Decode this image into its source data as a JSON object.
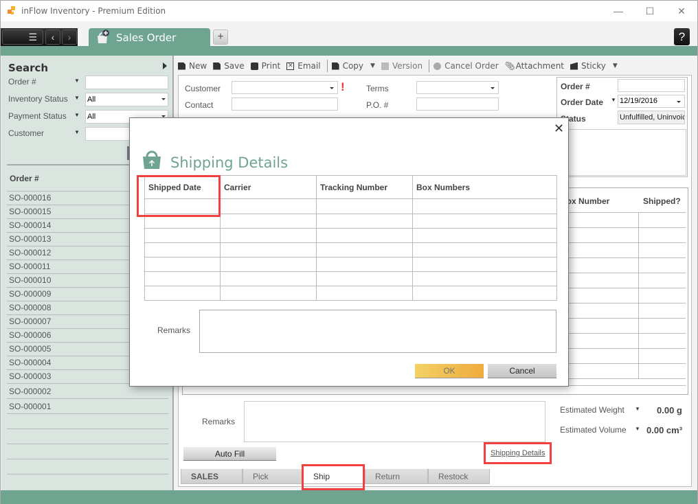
{
  "window": {
    "title": "inFlow Inventory - Premium Edition",
    "minimize": "—",
    "maximize": "☐",
    "close": "✕"
  },
  "tabs": {
    "active": "Sales Order",
    "add": "+",
    "help": "?"
  },
  "toolbar": {
    "items": [
      "New",
      "Save",
      "Print",
      "Email",
      "Copy",
      "Version",
      "Cancel Order",
      "Attachment",
      "Sticky"
    ]
  },
  "sidebar": {
    "title": "Search",
    "filters": [
      {
        "label": "Order #",
        "value": ""
      },
      {
        "label": "Inventory Status",
        "value": "All"
      },
      {
        "label": "Payment Status",
        "value": "All"
      },
      {
        "label": "Customer",
        "value": ""
      }
    ],
    "column_header": "Order #",
    "orders": [
      "SO-000016",
      "SO-000015",
      "SO-000014",
      "SO-000013",
      "SO-000012",
      "SO-000011",
      "SO-000010",
      "SO-000009",
      "SO-000008",
      "SO-000007",
      "SO-000006",
      "SO-000005",
      "SO-000004",
      "SO-000003",
      "SO-000002",
      "SO-000001"
    ]
  },
  "form": {
    "customer_label": "Customer",
    "contact_label": "Contact",
    "terms_label": "Terms",
    "po_label": "P.O. #",
    "required_mark": "!",
    "order_number_label": "Order #",
    "order_date_label": "Order Date",
    "order_date_value": "12/19/2016",
    "status_label": "Status",
    "status_value": "Unfulfilled, Uninvoic",
    "items_headers": [
      "Box Number",
      "Shipped?"
    ],
    "remarks_label": "Remarks",
    "est_weight_label": "Estimated Weight",
    "est_weight_value": "0.00 g",
    "est_volume_label": "Estimated Volume",
    "est_volume_value": "0.00 cm³",
    "autofill_label": "Auto Fill",
    "shipping_details_link": "Shipping Details"
  },
  "bottom_tabs": [
    "SALES",
    "Pick",
    "Ship",
    "Return",
    "Restock"
  ],
  "active_bottom_tab": "Ship",
  "dialog": {
    "title": "Shipping Details",
    "close": "✕",
    "columns": [
      "Shipped Date",
      "Carrier",
      "Tracking Number",
      "Box Numbers"
    ],
    "rows": 7,
    "remarks_label": "Remarks",
    "ok_label": "OK",
    "cancel_label": "Cancel"
  },
  "colors": {
    "brand_green": "#6fa590",
    "highlight_red": "#f04040",
    "ok_yellow": "#f0b040"
  }
}
